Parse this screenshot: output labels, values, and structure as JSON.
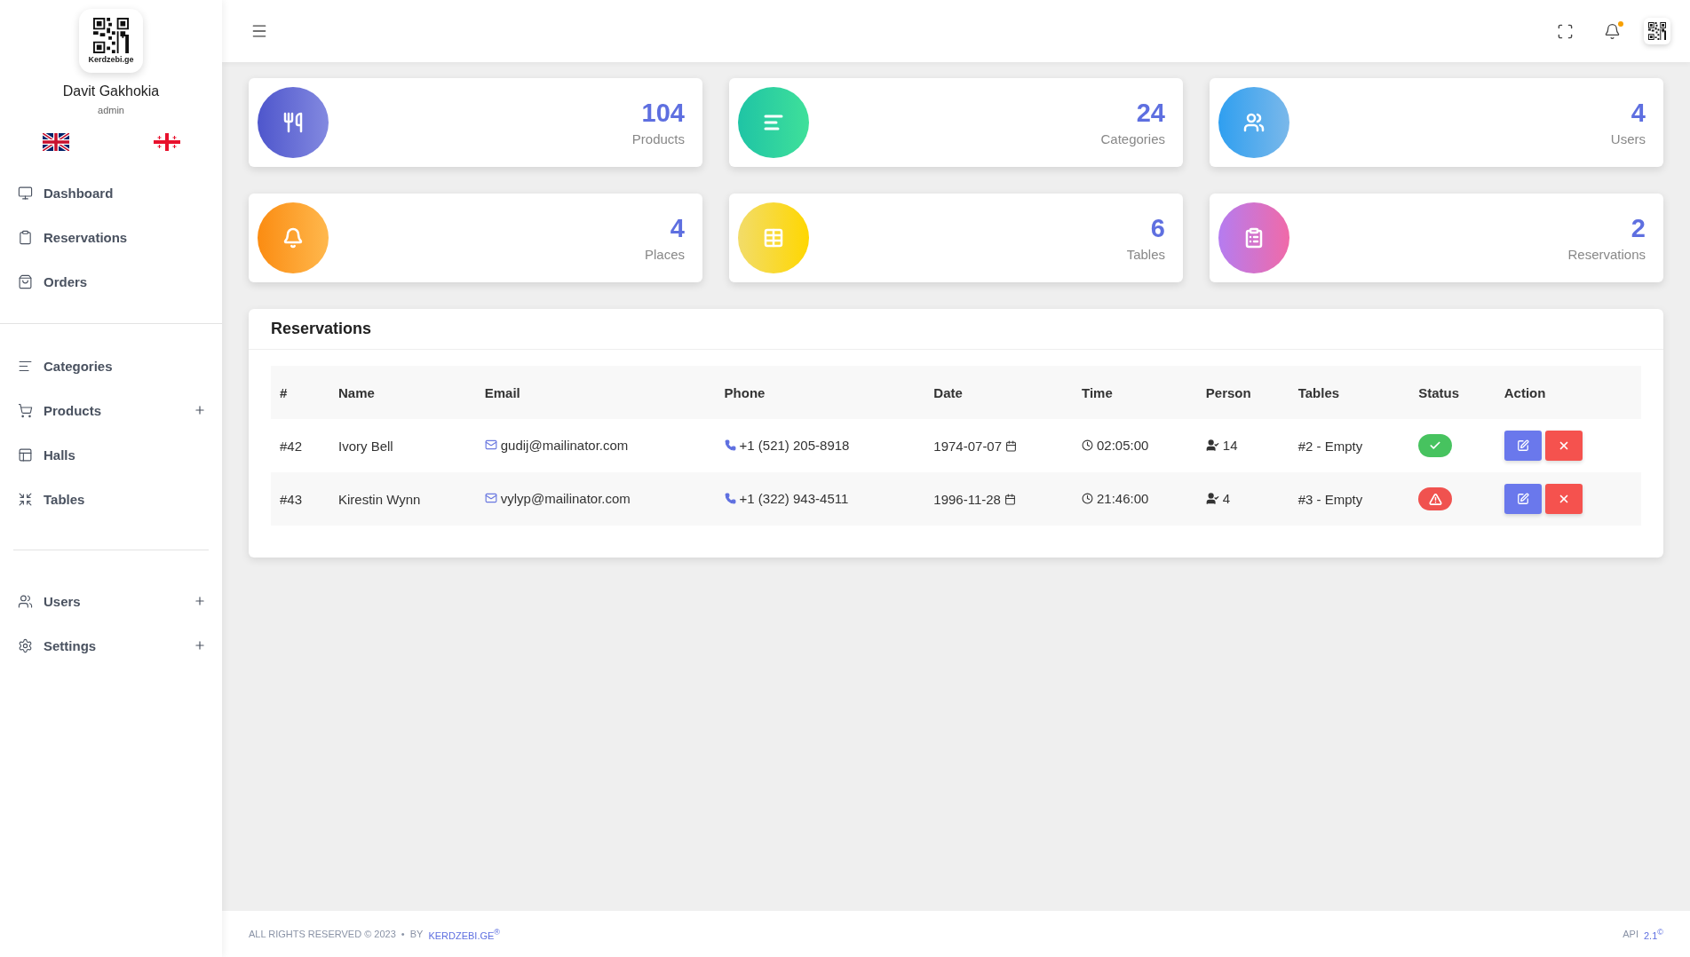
{
  "sidebar": {
    "logo_text": "Kerdzebi.ge",
    "user_name": "Davit Gakhokia",
    "user_role": "admin",
    "languages": [
      {
        "kind": "uk",
        "selected": false
      },
      {
        "kind": "georgia",
        "selected": false
      }
    ],
    "groups": [
      [
        {
          "label": "Dashboard",
          "kind": "monitor",
          "has_submenu": false
        },
        {
          "label": "Reservations",
          "kind": "clipboard",
          "has_submenu": false
        },
        {
          "label": "Orders",
          "kind": "bag",
          "has_submenu": false
        }
      ],
      [
        {
          "label": "Categories",
          "kind": "lines",
          "has_submenu": false
        },
        {
          "label": "Products",
          "kind": "cart",
          "has_submenu": true
        },
        {
          "label": "Halls",
          "kind": "layout",
          "has_submenu": false
        },
        {
          "label": "Tables",
          "kind": "shrink",
          "has_submenu": false
        }
      ],
      [
        {
          "label": "Users",
          "kind": "users",
          "has_submenu": true
        },
        {
          "label": "Settings",
          "kind": "gear",
          "has_submenu": true
        }
      ]
    ]
  },
  "topbar": {
    "notification_unread": true
  },
  "stats": [
    {
      "kind": "products",
      "value": "104",
      "label": "Products"
    },
    {
      "kind": "categories",
      "value": "24",
      "label": "Categories"
    },
    {
      "kind": "users",
      "value": "4",
      "label": "Users"
    },
    {
      "kind": "places",
      "value": "4",
      "label": "Places"
    },
    {
      "kind": "tables",
      "value": "6",
      "label": "Tables"
    },
    {
      "kind": "reservations",
      "value": "2",
      "label": "Reservations"
    }
  ],
  "reservations": {
    "title": "Reservations",
    "columns": [
      "#",
      "Name",
      "Email",
      "Phone",
      "Date",
      "Time",
      "Person",
      "Tables",
      "Status",
      "Action"
    ],
    "rows": [
      {
        "id": "#42",
        "name": "Ivory Bell",
        "email": "gudij@mailinator.com",
        "phone": "+1 (521) 205-8918",
        "date": "1974-07-07",
        "time": "02:05:00",
        "person": "14",
        "table": "#2 - Empty",
        "kind": "ok"
      },
      {
        "id": "#43",
        "name": "Kirestin Wynn",
        "email": "vylyp@mailinator.com",
        "phone": "+1 (322) 943-4511",
        "date": "1996-11-28",
        "time": "21:46:00",
        "person": "4",
        "table": "#3 - Empty",
        "kind": "alert"
      }
    ]
  },
  "footer": {
    "rights": "ALL RIGHTS RESERVED © 2023",
    "separator": "•",
    "by": "BY",
    "brand": "KERDZEBI.GE$^{®}$",
    "api_label": "API",
    "api_version": "2.1$^{©}$"
  }
}
